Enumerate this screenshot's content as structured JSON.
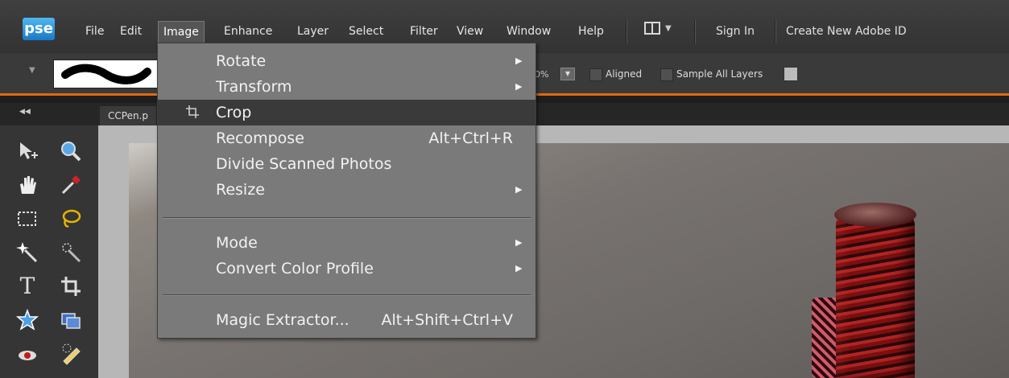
{
  "app": {
    "logo": "pse"
  },
  "menubar": {
    "items": [
      "File",
      "Edit",
      "Image",
      "Enhance",
      "Layer",
      "Select",
      "Filter",
      "View",
      "Window",
      "Help"
    ],
    "active": "Image",
    "sign_in": "Sign In",
    "create_id": "Create New Adobe ID"
  },
  "options": {
    "percent": "0%",
    "aligned_label": "Aligned",
    "sample_all_label": "Sample All Layers"
  },
  "document": {
    "tab_label": "CCPen.p"
  },
  "image_menu": {
    "items": [
      {
        "label": "Rotate",
        "shortcut": "",
        "submenu": true
      },
      {
        "label": "Transform",
        "shortcut": "",
        "submenu": true
      },
      {
        "label": "Crop",
        "shortcut": "",
        "submenu": false,
        "highlighted": true,
        "icon": "crop-icon"
      },
      {
        "label": "Recompose",
        "shortcut": "Alt+Ctrl+R",
        "submenu": false
      },
      {
        "label": "Divide Scanned Photos",
        "shortcut": "",
        "submenu": false
      },
      {
        "label": "Resize",
        "shortcut": "",
        "submenu": true
      },
      {
        "label": "Mode",
        "shortcut": "",
        "submenu": true
      },
      {
        "label": "Convert Color Profile",
        "shortcut": "",
        "submenu": true
      },
      {
        "label": "Magic Extractor...",
        "shortcut": "Alt+Shift+Ctrl+V",
        "submenu": false
      }
    ]
  },
  "colors": {
    "accent": "#e06a12",
    "menu_bg": "#7a7a7a",
    "highlight": "#3a3a3a"
  }
}
